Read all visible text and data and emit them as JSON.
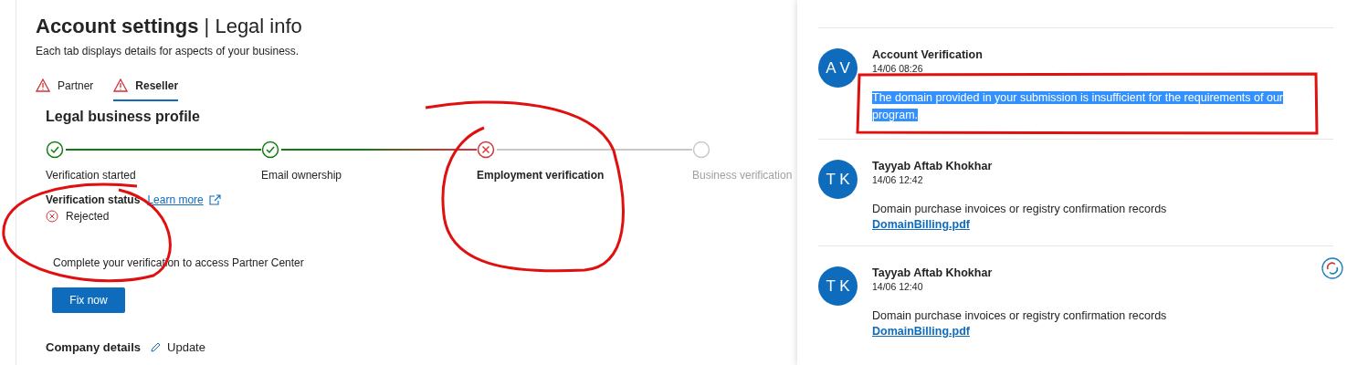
{
  "page": {
    "title": "**Account settings** | Legal info",
    "description": "Each tab displays details for aspects of your business."
  },
  "tabs": [
    {
      "label": "Partner",
      "selected": false,
      "warning": true
    },
    {
      "label": "Reseller",
      "selected": true,
      "warning": true
    }
  ],
  "profile": {
    "heading": "Legal business profile",
    "steps": [
      {
        "label": "Verification started",
        "complete": true,
        "failed": false
      },
      {
        "label": "Email ownership",
        "complete": true,
        "failed": false
      },
      {
        "label": "Employment verification",
        "complete": false,
        "failed": true
      },
      {
        "label": "Business verification",
        "complete": false,
        "failed": false
      }
    ],
    "status_label": "Verification status",
    "learn_more": "Learn more",
    "status": "Rejected",
    "message": "Complete your verification to access Partner Center",
    "button": "Fix now"
  },
  "company": {
    "heading": "Company details",
    "action": "Update"
  },
  "messages": [
    {
      "initials": "A V",
      "author": "Account Verification",
      "time": "14/06 08:26",
      "text": "The domain provided in your submission is insufficient for the requirements of our program.",
      "highlighted": true
    },
    {
      "initials": "T K",
      "author": "Tayyab Aftab Khokhar",
      "time": "14/06 12:42",
      "text": "Domain purchase invoices or registry confirmation records",
      "attachment": "DomainBilling.pdf",
      "highlighted": false
    },
    {
      "initials": "T K",
      "author": "Tayyab Aftab Khokhar",
      "time": "14/06 12:40",
      "text": "Domain purchase invoices or registry confirmation records",
      "attachment": "DomainBilling.pdf",
      "highlighted": false
    }
  ]
}
